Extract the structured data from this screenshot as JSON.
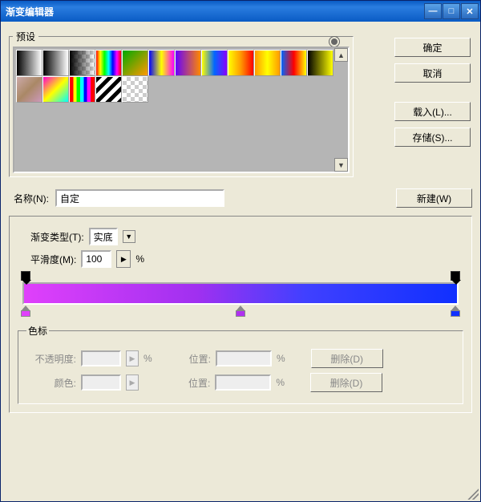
{
  "window": {
    "title": "渐变编辑器"
  },
  "preset": {
    "legend": "预设"
  },
  "buttons": {
    "ok": "确定",
    "cancel": "取消",
    "load": "载入(L)...",
    "save": "存储(S)...",
    "new": "新建(W)",
    "delete1": "删除(D)",
    "delete2": "删除(D)"
  },
  "name": {
    "label": "名称(N):",
    "value": "自定"
  },
  "gradient": {
    "typeLabel": "渐变类型(T):",
    "typeValue": "实底",
    "smoothLabel": "平滑度(M):",
    "smoothValue": "100",
    "smoothUnit": "%"
  },
  "stops": {
    "legend": "色标",
    "opacityLabel": "不透明度:",
    "opacityUnit": "%",
    "colorLabel": "颜色:",
    "positionLabel": "位置:",
    "positionUnit": "%"
  },
  "gradientStops": {
    "colorLeft": "#e040fb",
    "colorMid": "#b030f0",
    "colorRight": "#1030ff"
  }
}
